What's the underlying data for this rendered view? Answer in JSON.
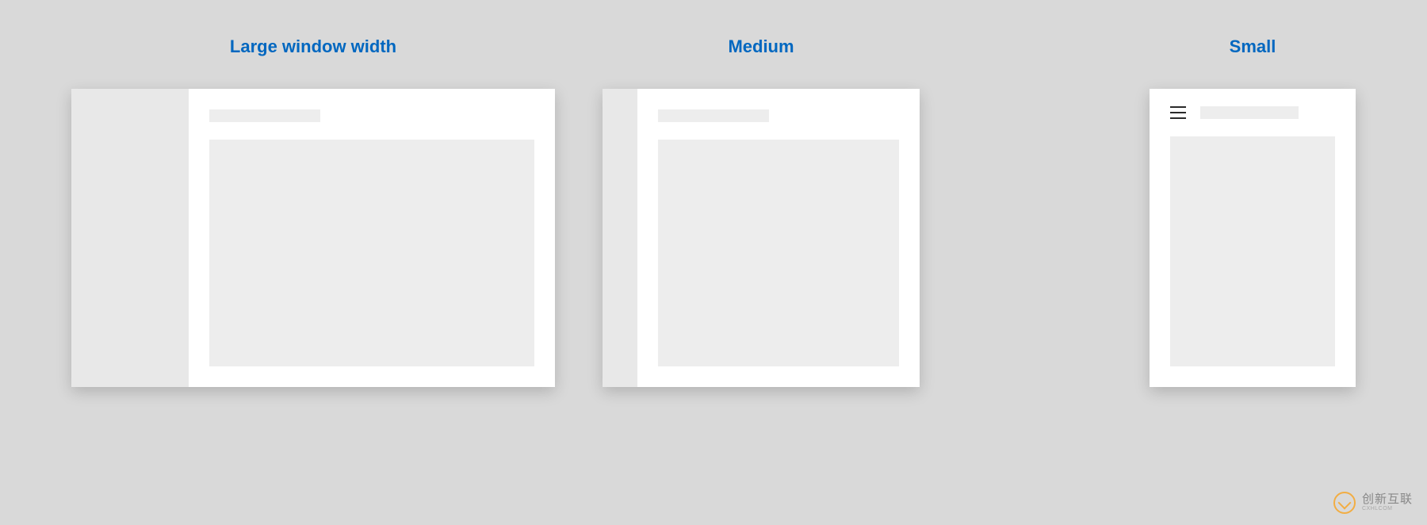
{
  "labels": {
    "large": "Large window width",
    "medium": "Medium",
    "small": "Small"
  },
  "watermark": {
    "brand": "创新互联",
    "sub": "CXHLCOM"
  }
}
